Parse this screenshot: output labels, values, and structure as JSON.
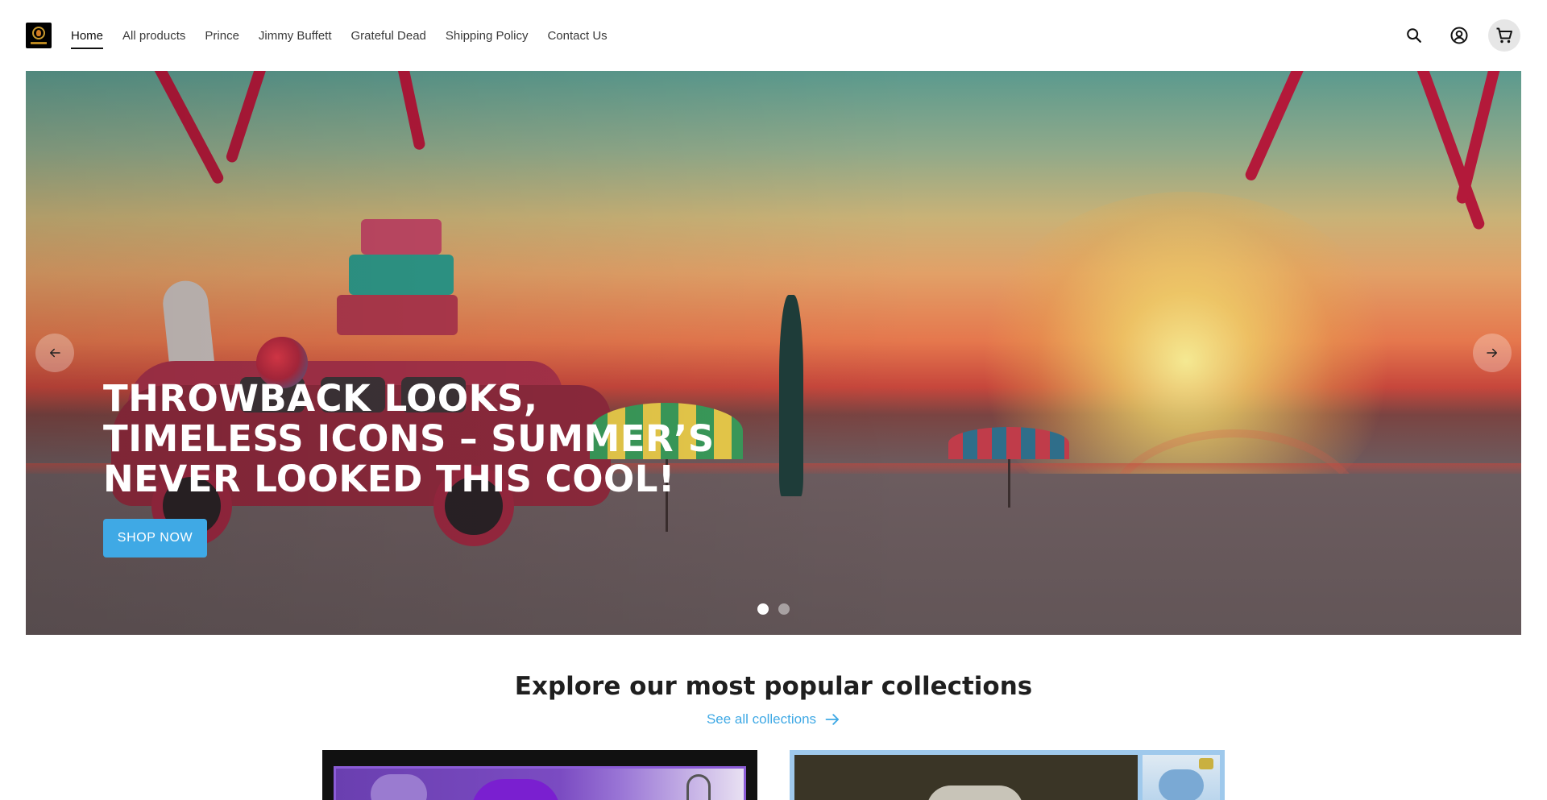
{
  "header": {
    "nav": [
      {
        "label": "Home",
        "active": true
      },
      {
        "label": "All products",
        "active": false
      },
      {
        "label": "Prince",
        "active": false
      },
      {
        "label": "Jimmy Buffett",
        "active": false
      },
      {
        "label": "Grateful Dead",
        "active": false
      },
      {
        "label": "Shipping Policy",
        "active": false
      },
      {
        "label": "Contact Us",
        "active": false
      }
    ],
    "icons": [
      "search-icon",
      "account-icon",
      "cart-icon"
    ]
  },
  "hero": {
    "title": "THROWBACK LOOKS, TIMELESS ICONS – SUMMER’S NEVER LOOKED THIS COOL!",
    "button_label": "SHOP NOW",
    "slide_count": 2,
    "active_slide": 1,
    "accent_color": "#3fa9e5"
  },
  "collections": {
    "title": "Explore our most popular collections",
    "see_all_label": "See all collections"
  }
}
